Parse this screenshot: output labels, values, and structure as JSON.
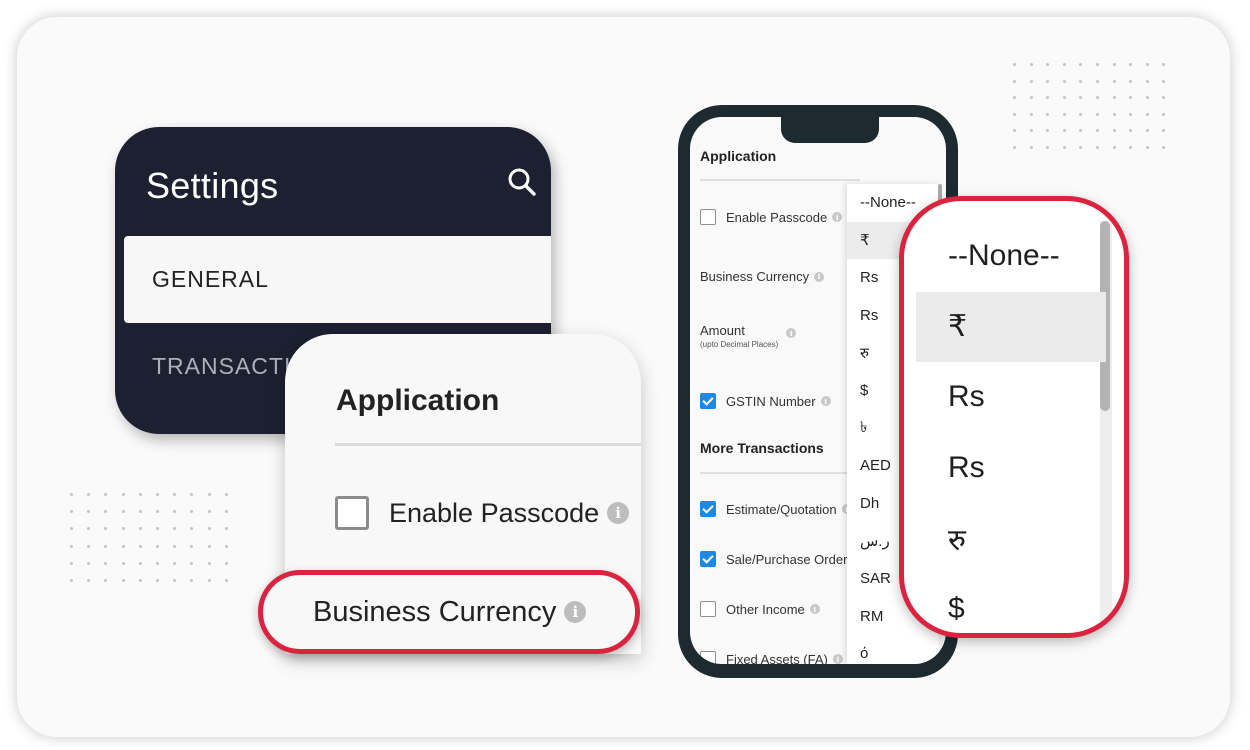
{
  "settings_card": {
    "title": "Settings",
    "search_icon": "search-icon",
    "tabs": [
      {
        "label": "GENERAL",
        "active": true
      },
      {
        "label": "TRANSACTIONS",
        "active": false
      }
    ]
  },
  "application_card": {
    "heading": "Application",
    "enable_passcode": {
      "label": "Enable Passcode",
      "checked": false,
      "info_icon": "info-icon"
    },
    "business_currency": {
      "label": "Business Currency",
      "info_icon": "info-icon",
      "highlighted": true
    }
  },
  "phone": {
    "section_application": "Application",
    "rows": [
      {
        "label": "Enable Passcode",
        "type": "checkbox",
        "checked": false
      },
      {
        "label": "Business Currency",
        "type": "dropdown"
      },
      {
        "label": "Amount",
        "sublabel": "(upto Decimal Places)",
        "type": "value"
      },
      {
        "label": "GSTIN Number",
        "type": "checkbox",
        "checked": true
      }
    ],
    "section_more": "More Transactions",
    "more_rows": [
      {
        "label": "Estimate/Quotation",
        "checked": true
      },
      {
        "label": "Sale/Purchase Order",
        "checked": true
      },
      {
        "label": "Other Income",
        "checked": false
      },
      {
        "label": "Fixed Assets (FA)",
        "checked": false
      }
    ],
    "currency_options": [
      "--None--",
      "₹",
      "Rs",
      "Rs",
      "रु",
      "$",
      "৳",
      "AED",
      "Dh",
      "ر.س",
      "SAR",
      "RM",
      "ό"
    ],
    "highlighted_option": "₹"
  },
  "currency_callout": {
    "options": [
      "--None--",
      "₹",
      "Rs",
      "Rs",
      "रु",
      "$"
    ],
    "highlighted_option": "₹"
  },
  "colors": {
    "highlight_border": "#d9233f",
    "checkbox_checked": "#1e88e5",
    "settings_bg": "#1c2030",
    "phone_frame": "#1d2a30"
  },
  "info_glyph": "i"
}
